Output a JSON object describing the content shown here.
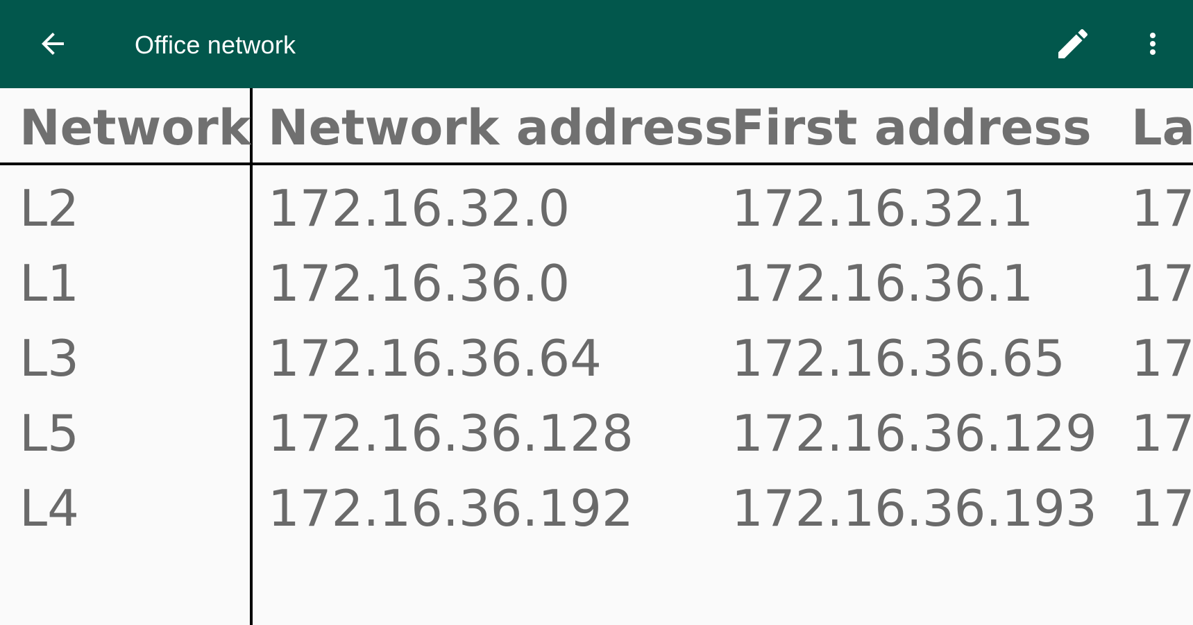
{
  "appbar": {
    "title": "Office network",
    "back_icon": "arrow-left-icon",
    "edit_icon": "pencil-icon",
    "more_icon": "more-vert-icon",
    "background": "#02574c"
  },
  "table": {
    "columns": [
      "Network",
      "Network address",
      "First address",
      "La"
    ],
    "rows": [
      [
        "L2",
        "172.16.32.0",
        "172.16.32.1",
        "17"
      ],
      [
        "L1",
        "172.16.36.0",
        "172.16.36.1",
        "17"
      ],
      [
        "L3",
        "172.16.36.64",
        "172.16.36.65",
        "17"
      ],
      [
        "L5",
        "172.16.36.128",
        "172.16.36.129",
        "17"
      ],
      [
        "L4",
        "172.16.36.192",
        "172.16.36.193",
        "17"
      ]
    ]
  }
}
